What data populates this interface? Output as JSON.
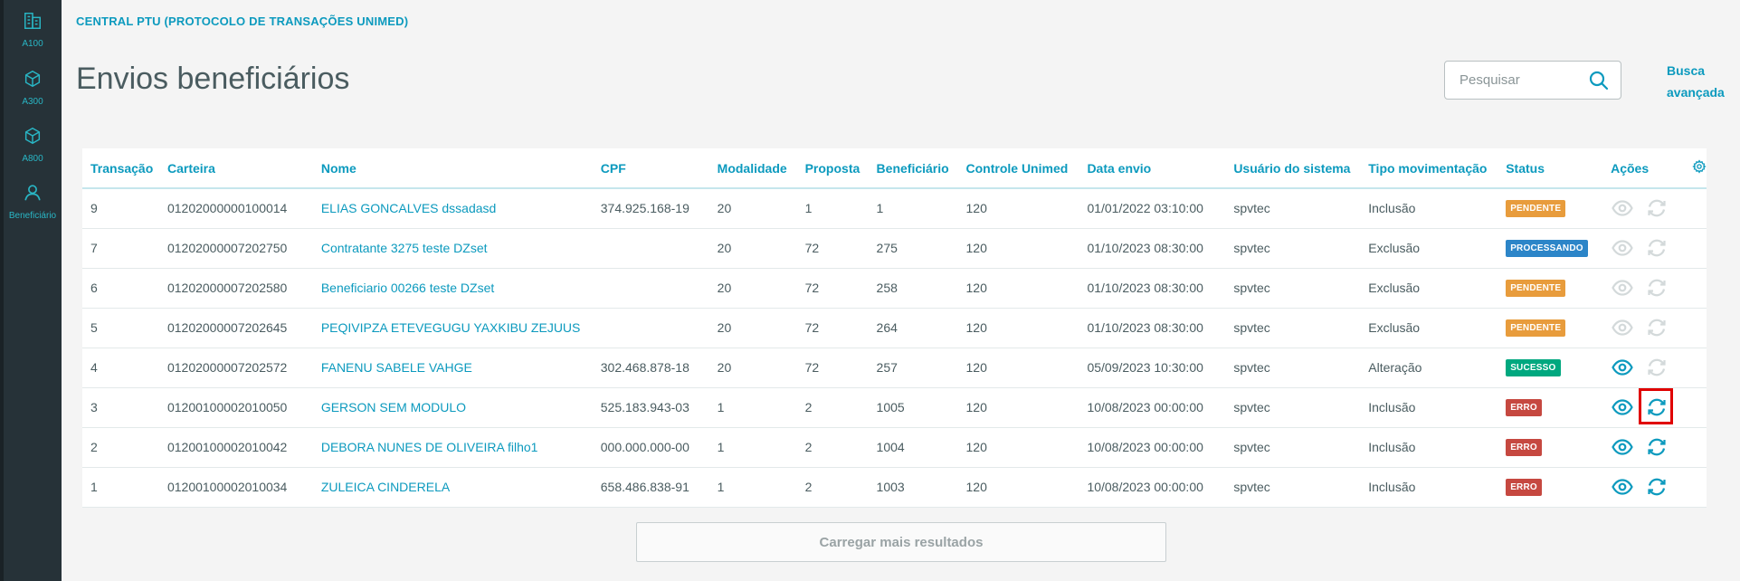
{
  "sidebar": {
    "items": [
      {
        "label": "A100",
        "icon": "building-icon"
      },
      {
        "label": "A300",
        "icon": "cube-icon"
      },
      {
        "label": "A800",
        "icon": "cube-icon"
      },
      {
        "label": "Beneficiário",
        "icon": "person-icon"
      }
    ]
  },
  "header": {
    "breadcrumb": "CENTRAL PTU (PROTOCOLO DE TRANSAÇÕES UNIMED)",
    "title": "Envios beneficiários",
    "search_placeholder": "Pesquisar",
    "advanced_search_line1": "Busca",
    "advanced_search_line2": "avançada"
  },
  "table": {
    "columns": [
      "Transação",
      "Carteira",
      "Nome",
      "CPF",
      "Modalidade",
      "Proposta",
      "Beneficiário",
      "Controle Unimed",
      "Data envio",
      "Usuário do sistema",
      "Tipo movimentação",
      "Status",
      "Ações"
    ],
    "rows": [
      {
        "transacao": "9",
        "carteira": "01202000000100014",
        "nome": "ELIAS GONCALVES dssadasd",
        "cpf": "374.925.168-19",
        "modalidade": "20",
        "proposta": "1",
        "beneficiario": "1",
        "controle": "120",
        "data": "01/01/2022 03:10:00",
        "usuario": "spvtec",
        "tipo": "Inclusão",
        "status": "PENDENTE",
        "view_enabled": false,
        "resend_enabled": false,
        "highlight": false
      },
      {
        "transacao": "7",
        "carteira": "01202000007202750",
        "nome": "Contratante 3275 teste DZset",
        "cpf": "",
        "modalidade": "20",
        "proposta": "72",
        "beneficiario": "275",
        "controle": "120",
        "data": "01/10/2023 08:30:00",
        "usuario": "spvtec",
        "tipo": "Exclusão",
        "status": "PROCESSANDO",
        "view_enabled": false,
        "resend_enabled": false,
        "highlight": false
      },
      {
        "transacao": "6",
        "carteira": "01202000007202580",
        "nome": "Beneficiario 00266 teste DZset",
        "cpf": "",
        "modalidade": "20",
        "proposta": "72",
        "beneficiario": "258",
        "controle": "120",
        "data": "01/10/2023 08:30:00",
        "usuario": "spvtec",
        "tipo": "Exclusão",
        "status": "PENDENTE",
        "view_enabled": false,
        "resend_enabled": false,
        "highlight": false
      },
      {
        "transacao": "5",
        "carteira": "01202000007202645",
        "nome": "PEQIVIPZA ETEVEGUGU YAXKIBU ZEJUUS",
        "cpf": "",
        "modalidade": "20",
        "proposta": "72",
        "beneficiario": "264",
        "controle": "120",
        "data": "01/10/2023 08:30:00",
        "usuario": "spvtec",
        "tipo": "Exclusão",
        "status": "PENDENTE",
        "view_enabled": false,
        "resend_enabled": false,
        "highlight": false
      },
      {
        "transacao": "4",
        "carteira": "01202000007202572",
        "nome": "FANENU SABELE VAHGE",
        "cpf": "302.468.878-18",
        "modalidade": "20",
        "proposta": "72",
        "beneficiario": "257",
        "controle": "120",
        "data": "05/09/2023 10:30:00",
        "usuario": "spvtec",
        "tipo": "Alteração",
        "status": "SUCESSO",
        "view_enabled": true,
        "resend_enabled": false,
        "highlight": false
      },
      {
        "transacao": "3",
        "carteira": "01200100002010050",
        "nome": "GERSON SEM MODULO",
        "cpf": "525.183.943-03",
        "modalidade": "1",
        "proposta": "2",
        "beneficiario": "1005",
        "controle": "120",
        "data": "10/08/2023 00:00:00",
        "usuario": "spvtec",
        "tipo": "Inclusão",
        "status": "ERRO",
        "view_enabled": true,
        "resend_enabled": true,
        "highlight": true
      },
      {
        "transacao": "2",
        "carteira": "01200100002010042",
        "nome": "DEBORA NUNES DE OLIVEIRA filho1",
        "cpf": "000.000.000-00",
        "modalidade": "1",
        "proposta": "2",
        "beneficiario": "1004",
        "controle": "120",
        "data": "10/08/2023 00:00:00",
        "usuario": "spvtec",
        "tipo": "Inclusão",
        "status": "ERRO",
        "view_enabled": true,
        "resend_enabled": true,
        "highlight": false
      },
      {
        "transacao": "1",
        "carteira": "01200100002010034",
        "nome": "ZULEICA CINDERELA",
        "cpf": "658.486.838-91",
        "modalidade": "1",
        "proposta": "2",
        "beneficiario": "1003",
        "controle": "120",
        "data": "10/08/2023 00:00:00",
        "usuario": "spvtec",
        "tipo": "Inclusão",
        "status": "ERRO",
        "view_enabled": true,
        "resend_enabled": true,
        "highlight": false
      }
    ]
  },
  "status_colors": {
    "PENDENTE": "#e89c3c",
    "PROCESSANDO": "#2c85c8",
    "SUCESSO": "#00a87f",
    "ERRO": "#c64840"
  },
  "load_more_label": "Carregar mais resultados"
}
